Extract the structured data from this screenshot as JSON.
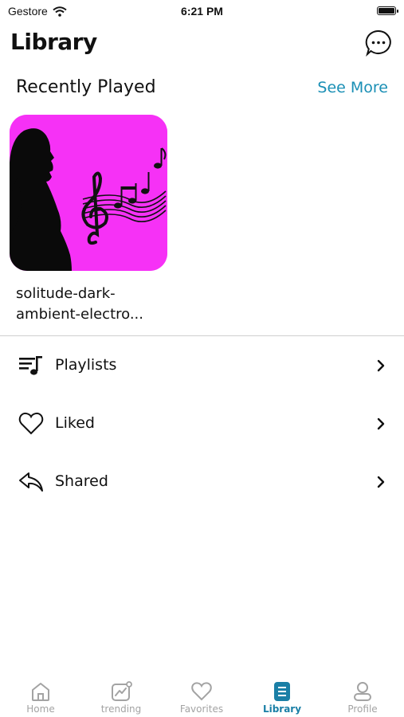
{
  "status_bar": {
    "carrier": "Gestore",
    "time": "6:21 PM"
  },
  "header": {
    "title": "Library",
    "chat_icon": "chat-bubble-icon"
  },
  "recently_played": {
    "title": "Recently Played",
    "see_more_label": "See More",
    "items": [
      {
        "title": "solitude-dark-ambient-electro...",
        "artwork": "music-silhouette-artwork"
      }
    ]
  },
  "menu": [
    {
      "label": "Playlists",
      "icon": "playlist-icon"
    },
    {
      "label": "Liked",
      "icon": "heart-icon"
    },
    {
      "label": "Shared",
      "icon": "share-reply-icon"
    }
  ],
  "tab_bar": {
    "tabs": [
      {
        "label": "Home",
        "icon": "home-icon"
      },
      {
        "label": "trending",
        "icon": "trending-icon"
      },
      {
        "label": "Favorites",
        "icon": "heart-icon"
      },
      {
        "label": "Library",
        "icon": "library-icon",
        "active": true
      },
      {
        "label": "Profile",
        "icon": "profile-icon"
      }
    ]
  },
  "colors": {
    "accent": "#1a8fb5",
    "artwork_bg": "#f631f6",
    "inactive": "#a3a3a3"
  }
}
